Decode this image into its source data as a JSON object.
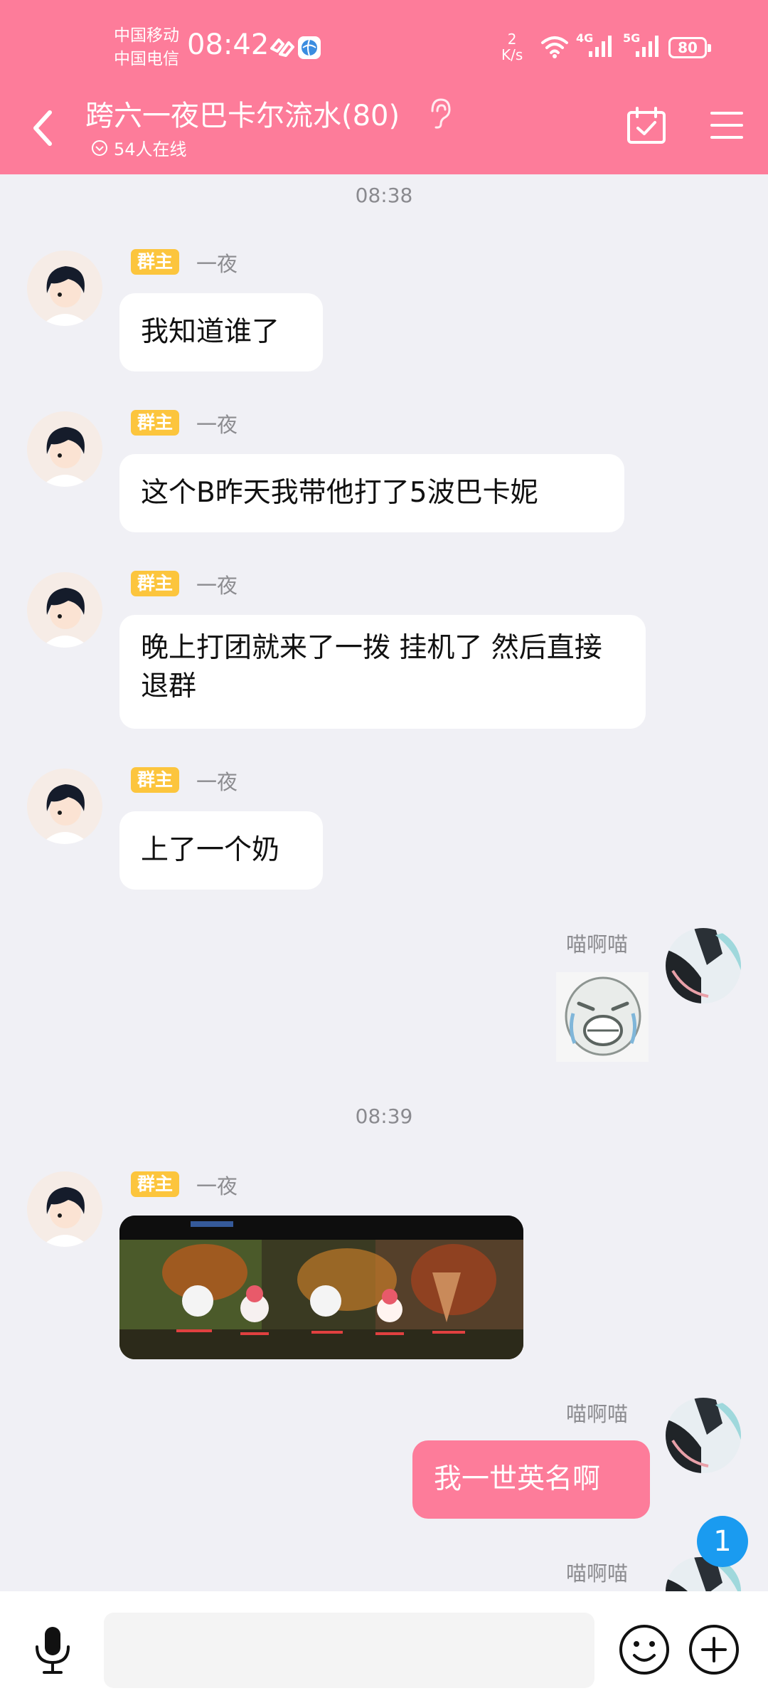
{
  "status_bar": {
    "carrier1": "中国移动",
    "carrier2": "中国电信",
    "time": "08:42",
    "speed_value": "2",
    "speed_unit": "K/s",
    "net1": "4G",
    "net2": "5G",
    "battery": "80"
  },
  "header": {
    "title": "跨六一夜巴卡尔流水(80)",
    "online": "54人在线"
  },
  "chat": {
    "time1": "08:38",
    "time2": "08:39",
    "messages": [
      {
        "badge": "群主",
        "sender": "一夜",
        "text": "我知道谁了"
      },
      {
        "badge": "群主",
        "sender": "一夜",
        "text": "这个B昨天我带他打了5波巴卡妮"
      },
      {
        "badge": "群主",
        "sender": "一夜",
        "text": "晚上打团就来了一拨 挂机了 然后直接退群"
      },
      {
        "badge": "群主",
        "sender": "一夜",
        "text": "上了一个奶"
      },
      {
        "sender": "喵啊喵"
      },
      {
        "badge": "群主",
        "sender": "一夜"
      },
      {
        "sender": "喵啊喵",
        "text": "我一世英名啊"
      },
      {
        "sender": "喵啊喵"
      }
    ],
    "unread_count": "1"
  },
  "input_bar": {
    "placeholder": ""
  },
  "colors": {
    "brand": "#fd7c9a",
    "badge": "#fcc53d",
    "unread": "#1a9bf0"
  }
}
